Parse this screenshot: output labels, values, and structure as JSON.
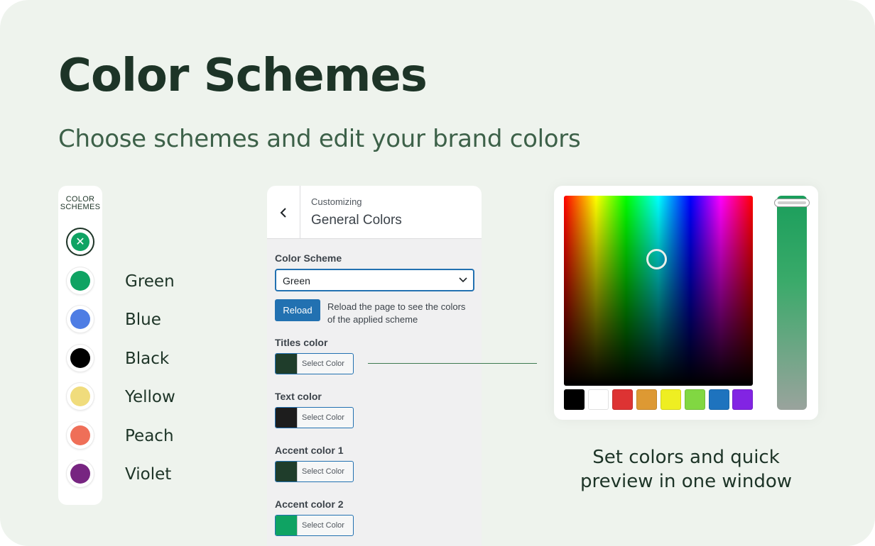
{
  "heading": "Color Schemes",
  "subheading": "Choose schemes and edit your brand colors",
  "swatch_panel": {
    "title": "COLOR\nSCHEMES",
    "selected_icon": "close-icon",
    "selected_color": "#0fa363",
    "schemes": [
      {
        "label": "Green",
        "color": "#0fa363"
      },
      {
        "label": "Blue",
        "color": "#4e7de4"
      },
      {
        "label": "Black",
        "color": "#000000"
      },
      {
        "label": "Yellow",
        "color": "#f0dc7c"
      },
      {
        "label": "Peach",
        "color": "#ef6f58"
      },
      {
        "label": "Violet",
        "color": "#772581"
      }
    ]
  },
  "customizer": {
    "back_icon": "chevron-left-icon",
    "subtitle": "Customizing",
    "title": "General Colors",
    "scheme_label": "Color Scheme",
    "scheme_value": "Green",
    "dropdown_icon": "chevron-down-icon",
    "reload_label": "Reload",
    "reload_note": "Reload the page to see the colors of the applied scheme",
    "color_fields": [
      {
        "label": "Titles color",
        "button": "Select Color",
        "color": "#1f3d2b"
      },
      {
        "label": "Text color",
        "button": "Select Color",
        "color": "#1d1d1d"
      },
      {
        "label": "Accent color 1",
        "button": "Select Color",
        "color": "#1f3d2b"
      },
      {
        "label": "Accent color 2",
        "button": "Select Color",
        "color": "#0fa363"
      }
    ]
  },
  "picker": {
    "slider_colors": [
      "#1a9e5b",
      "#9aa39d"
    ],
    "palette": [
      "#000000",
      "#ffffff",
      "#dd3333",
      "#dd9933",
      "#eeee22",
      "#81d742",
      "#1e73be",
      "#8224e3"
    ]
  },
  "caption": "Set colors and quick preview in one window"
}
